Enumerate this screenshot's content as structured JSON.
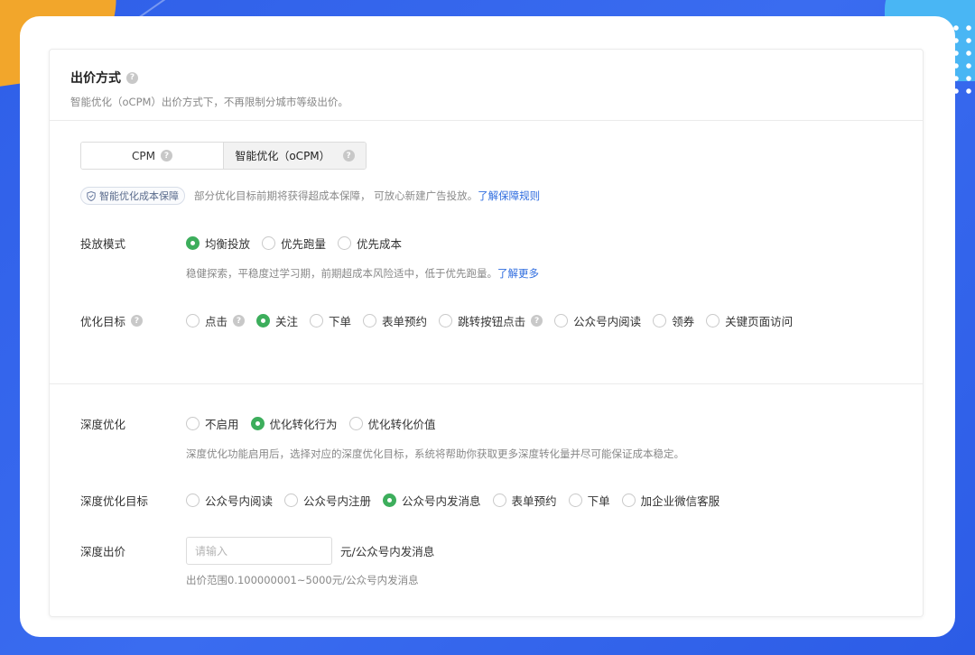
{
  "colors": {
    "accent": "#3dae5c",
    "link": "#2e6cdf",
    "background": "#2f5fe8"
  },
  "header": {
    "title": "出价方式",
    "subtitle": "智能优化（oCPM）出价方式下，不再限制分城市等级出价。"
  },
  "segment": {
    "cpm_label": "CPM",
    "ocpm_label": "智能优化（oCPM）",
    "selected": "智能优化（oCPM）"
  },
  "guarantee": {
    "badge": "智能优化成本保障",
    "text": "部分优化目标前期将获得超成本保障， 可放心新建广告投放。",
    "link": "了解保障规则"
  },
  "delivery_mode": {
    "label": "投放模式",
    "options": [
      "均衡投放",
      "优先跑量",
      "优先成本"
    ],
    "selected": "均衡投放",
    "hint": "稳健探索，平稳度过学习期，前期超成本风险适中，低于优先跑量。",
    "hint_link": "了解更多"
  },
  "optimization_goal": {
    "label": "优化目标",
    "options": [
      "点击",
      "关注",
      "下单",
      "表单预约",
      "跳转按钮点击",
      "公众号内阅读",
      "领券",
      "关键页面访问"
    ],
    "selected": "关注"
  },
  "deep_optimization": {
    "label": "深度优化",
    "options": [
      "不启用",
      "优化转化行为",
      "优化转化价值"
    ],
    "selected": "优化转化行为",
    "hint": "深度优化功能启用后，选择对应的深度优化目标，系统将帮助你获取更多深度转化量并尽可能保证成本稳定。"
  },
  "deep_goal": {
    "label": "深度优化目标",
    "options": [
      "公众号内阅读",
      "公众号内注册",
      "公众号内发消息",
      "表单预约",
      "下单",
      "加企业微信客服"
    ],
    "selected": "公众号内发消息"
  },
  "deep_bid": {
    "label": "深度出价",
    "placeholder": "请输入",
    "value": "",
    "unit": "元/公众号内发消息",
    "range_hint": "出价范围0.100000001~5000元/公众号内发消息"
  },
  "icons": [
    "question-icon",
    "shield-icon"
  ]
}
